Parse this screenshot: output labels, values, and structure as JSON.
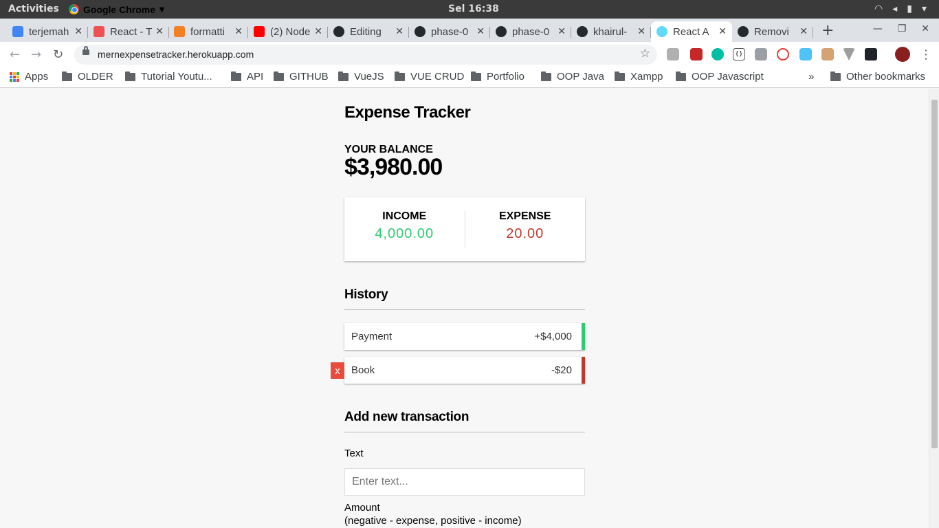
{
  "os": {
    "activities": "Activities",
    "app_name": "Google Chrome",
    "clock": "Sel 16:38"
  },
  "tabs": [
    {
      "title": "terjemah",
      "icon": "google-icon",
      "color": "#4285f4"
    },
    {
      "title": "React - T",
      "icon": "udemy-icon",
      "color": "#ec5252"
    },
    {
      "title": "formatti",
      "icon": "stackoverflow-icon",
      "color": "#f48024"
    },
    {
      "title": "(2) Node",
      "icon": "youtube-icon",
      "color": "#ff0000"
    },
    {
      "title": "Editing",
      "icon": "github-icon",
      "color": "#24292e"
    },
    {
      "title": "phase-0",
      "icon": "github-icon",
      "color": "#24292e"
    },
    {
      "title": "phase-0",
      "icon": "github-icon",
      "color": "#24292e"
    },
    {
      "title": "khairul-",
      "icon": "github-icon",
      "color": "#24292e"
    },
    {
      "title": "React A",
      "icon": "react-icon",
      "color": "#61dafb",
      "active": true
    },
    {
      "title": "Removi",
      "icon": "github-icon",
      "color": "#24292e"
    }
  ],
  "address_bar": {
    "url": "mernexpensetracker.herokuapp.com"
  },
  "bookmarks": [
    "Apps",
    "OLDER",
    "Tutorial Youtu...",
    "API",
    "GITHUB",
    "VueJS",
    "VUE CRUD",
    "Portfolio",
    "OOP Java",
    "Xampp",
    "OOP Javascript",
    "Other bookmarks"
  ],
  "page": {
    "title": "Expense Tracker",
    "balance_label": "YOUR BALANCE",
    "balance": "$3,980.00",
    "income_label": "INCOME",
    "income": "4,000.00",
    "expense_label": "EXPENSE",
    "expense": "20.00",
    "history_title": "History",
    "history": [
      {
        "text": "Payment",
        "amount": "+$4,000",
        "type": "plus"
      },
      {
        "text": "Book",
        "amount": "-$20",
        "type": "minus",
        "delete_label": "x"
      }
    ],
    "add_title": "Add new transaction",
    "text_label": "Text",
    "text_placeholder": "Enter text...",
    "amount_label": "Amount",
    "amount_hint": "(negative - expense, positive - income)"
  },
  "colors": {
    "income": "#2ecc71",
    "expense": "#c0392b",
    "delete": "#e74c3c"
  }
}
